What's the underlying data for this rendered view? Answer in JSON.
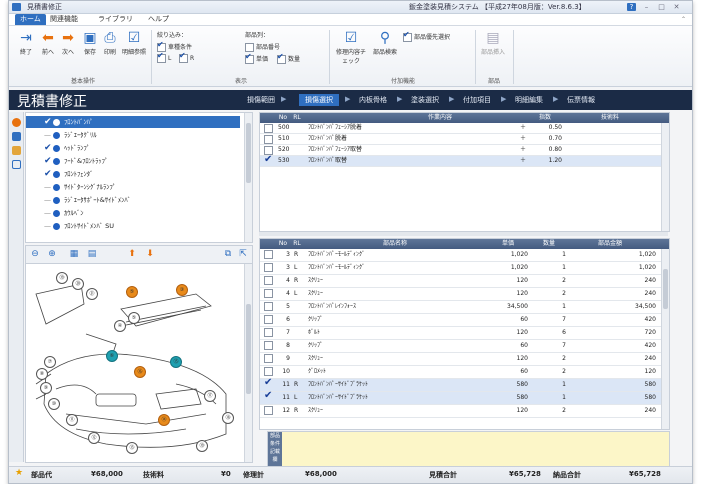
{
  "window": {
    "title": "見積書修正",
    "caption": "鈑金塗装見積システム 【平成27年08月版：Ver.8.6.3】"
  },
  "menubar": {
    "tabs": [
      "ホーム",
      "関連機能",
      "ライブラリ",
      "ヘルプ"
    ]
  },
  "ribbon": {
    "basic": {
      "buttons": [
        "終了",
        "前へ",
        "次へ",
        "保存",
        "印刷",
        "明細参照"
      ],
      "group_label": "基本操作"
    },
    "filter": {
      "label": "絞り込み：",
      "options": [
        "車種条件",
        "L",
        "R"
      ]
    },
    "parts_columns": {
      "label": "部品列：",
      "options": [
        "部品番号",
        "単価",
        "数量"
      ]
    },
    "display_group_label": "表示",
    "extra": {
      "buttons": [
        "修理内容チェック",
        "部品検索"
      ],
      "checkbox": "部品優先選択",
      "group_label": "付加機能"
    },
    "other": {
      "button": "部品挿入",
      "group_label": "部品"
    }
  },
  "header": {
    "title": "見積書修正",
    "steps": [
      "損傷範囲",
      "損傷選択",
      "内板骨格",
      "塗装選択",
      "付加項目",
      "明細編集",
      "伝票情報"
    ],
    "active_step": "損傷選択"
  },
  "tree": {
    "items": [
      {
        "label": "ﾌﾛﾝﾄﾊﾞﾝﾊﾟ",
        "checked": true
      },
      {
        "label": "ﾗｼﾞｴｰﾀｸﾞﾘﾙ",
        "checked": false
      },
      {
        "label": "ﾍｯﾄﾞﾗﾝﾌﾟ",
        "checked": true
      },
      {
        "label": "ﾌｰﾄﾞ&ﾌﾛﾝﾄﾗｯﾌﾟ",
        "checked": true
      },
      {
        "label": "ﾌﾛﾝﾄﾌｪﾝﾀﾞ",
        "checked": true
      },
      {
        "label": "ｻｲﾄﾞﾀｰﾝｼｸﾞﾅﾙﾗﾝﾌﾟ",
        "checked": false
      },
      {
        "label": "ﾗｼﾞｴｰﾀｻﾎﾟｰﾄ&ｻｲﾄﾞﾒﾝﾊﾞ",
        "checked": false
      },
      {
        "label": "ｶｳﾙﾍﾞﾝ",
        "checked": false
      },
      {
        "label": "ﾌﾛﾝﾄｻｲﾄﾞﾒﾝﾊﾞ SU",
        "checked": false
      }
    ]
  },
  "work_table": {
    "headers": [
      "No",
      "RL",
      "作業内容",
      "指数",
      "技術料"
    ],
    "rows": [
      {
        "no": "500",
        "rl": "",
        "name": "ﾌﾛﾝﾄﾊﾞﾝﾊﾟﾌｪｰｼｱ脱着",
        "sym": "＋",
        "index": "0.50",
        "fee": "",
        "checked": false
      },
      {
        "no": "510",
        "rl": "",
        "name": "ﾌﾛﾝﾄﾊﾞﾝﾊﾟ脱着",
        "sym": "＋",
        "index": "0.70",
        "fee": "",
        "checked": false
      },
      {
        "no": "520",
        "rl": "",
        "name": "ﾌﾛﾝﾄﾊﾞﾝﾊﾟﾌｪｰｼｱ取替",
        "sym": "＋",
        "index": "0.80",
        "fee": "",
        "checked": false
      },
      {
        "no": "530",
        "rl": "",
        "name": "ﾌﾛﾝﾄﾊﾞﾝﾊﾟ取替",
        "sym": "＋",
        "index": "1.20",
        "fee": "",
        "checked": true
      }
    ]
  },
  "parts_table": {
    "headers": [
      "No",
      "RL",
      "部品名称",
      "単価",
      "数量",
      "部品金額"
    ],
    "rows": [
      {
        "no": "3",
        "rl": "R",
        "name": "ﾌﾛﾝﾄﾊﾞﾝﾊﾟｰﾓｰﾙﾃﾞｨﾝｸﾞ",
        "price": "1,020",
        "qty": "1",
        "amount": "1,020",
        "checked": false
      },
      {
        "no": "3",
        "rl": "L",
        "name": "ﾌﾛﾝﾄﾊﾞﾝﾊﾟｰﾓｰﾙﾃﾞｨﾝｸﾞ",
        "price": "1,020",
        "qty": "1",
        "amount": "1,020",
        "checked": false
      },
      {
        "no": "4",
        "rl": "R",
        "name": "ｽｸﾘｭｰ",
        "price": "120",
        "qty": "2",
        "amount": "240",
        "checked": false
      },
      {
        "no": "4",
        "rl": "L",
        "name": "ｽｸﾘｭｰ",
        "price": "120",
        "qty": "2",
        "amount": "240",
        "checked": false
      },
      {
        "no": "5",
        "rl": "",
        "name": "ﾌﾛﾝﾄﾊﾞﾝﾊﾟﾚｲﾝﾌｫｰｽ",
        "price": "34,500",
        "qty": "1",
        "amount": "34,500",
        "checked": false
      },
      {
        "no": "6",
        "rl": "",
        "name": "ｸﾘｯﾌﾟ",
        "price": "60",
        "qty": "7",
        "amount": "420",
        "checked": false
      },
      {
        "no": "7",
        "rl": "",
        "name": "ﾎﾞﾙﾄ",
        "price": "120",
        "qty": "6",
        "amount": "720",
        "checked": false
      },
      {
        "no": "8",
        "rl": "",
        "name": "ｸﾘｯﾌﾟ",
        "price": "60",
        "qty": "7",
        "amount": "420",
        "checked": false
      },
      {
        "no": "9",
        "rl": "",
        "name": "ｽｸﾘｭｰ",
        "price": "120",
        "qty": "2",
        "amount": "240",
        "checked": false
      },
      {
        "no": "10",
        "rl": "",
        "name": "ｸﾞﾛﾒｯﾄ",
        "price": "60",
        "qty": "2",
        "amount": "120",
        "checked": false
      },
      {
        "no": "11",
        "rl": "R",
        "name": "ﾌﾛﾝﾄﾊﾞﾝﾊﾟｰｻｲﾄﾞﾌﾞﾗｹｯﾄ",
        "price": "580",
        "qty": "1",
        "amount": "580",
        "checked": true
      },
      {
        "no": "11",
        "rl": "L",
        "name": "ﾌﾛﾝﾄﾊﾞﾝﾊﾟｰｻｲﾄﾞﾌﾞﾗｹｯﾄ",
        "price": "580",
        "qty": "1",
        "amount": "580",
        "checked": true
      },
      {
        "no": "12",
        "rl": "R",
        "name": "ｽｸﾘｭｰ",
        "price": "120",
        "qty": "2",
        "amount": "240",
        "checked": false
      }
    ]
  },
  "memo": {
    "label": "部品条件記載欄"
  },
  "diagram": {
    "callouts": [
      "⑲",
      "⑳",
      "㉑",
      "⑤",
      "③",
      "④",
      "⑤",
      "⑥",
      "⑦",
      "⑧",
      "⑨",
      "⑩",
      "⑪",
      "⑫",
      "⑬",
      "⑭",
      "⑮",
      "⑯",
      "⑰",
      "⑱",
      "⑲"
    ]
  },
  "status": {
    "parts_label": "部品代",
    "parts_value": "¥68,000",
    "tech_label": "技術料",
    "tech_value": "¥0",
    "repair_label": "修理計",
    "repair_value": "¥68,000",
    "estimate_label": "見積合計",
    "estimate_value": "¥65,728",
    "delivery_label": "納品合計",
    "delivery_value": "¥65,728"
  },
  "colors": {
    "accent": "#2f6fc0",
    "header_band": "#1b2b46",
    "grid_header": "#445b80",
    "highlight_row": "#dbe6f6",
    "memo_bg": "#fcf6c8",
    "callout_orange": "#e88a1a",
    "callout_teal": "#1fa0b0"
  }
}
